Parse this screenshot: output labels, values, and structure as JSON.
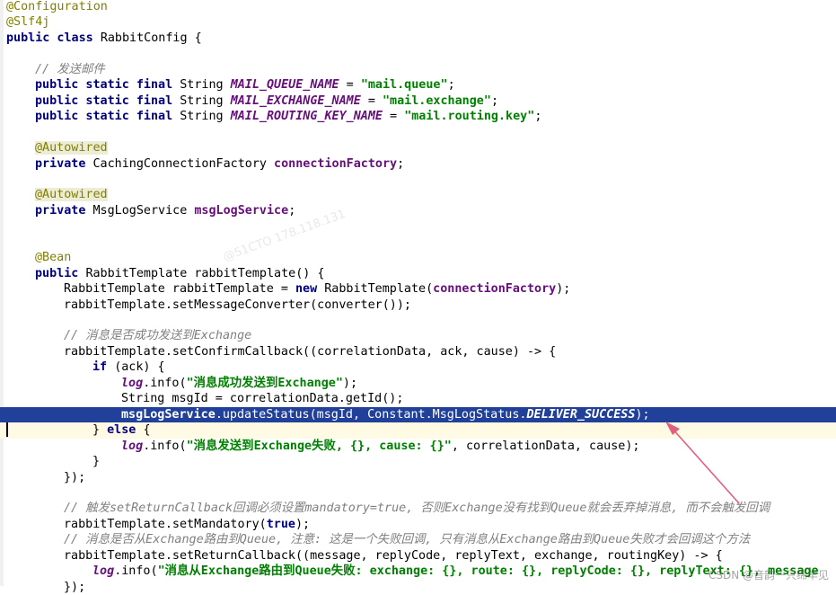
{
  "editor": {
    "lines": [
      {
        "indent": 0,
        "tokens": [
          {
            "t": "@Configuration",
            "c": "ann"
          }
        ]
      },
      {
        "indent": 0,
        "tokens": [
          {
            "t": "@Slf4j",
            "c": "ann"
          }
        ]
      },
      {
        "indent": 0,
        "tokens": [
          {
            "t": "public class ",
            "c": "kw"
          },
          {
            "t": "RabbitConfig {",
            "c": ""
          }
        ]
      },
      {
        "indent": 0,
        "tokens": []
      },
      {
        "indent": 1,
        "tokens": [
          {
            "t": "// 发送邮件",
            "c": "cmt"
          }
        ]
      },
      {
        "indent": 1,
        "tokens": [
          {
            "t": "public static final ",
            "c": "kw"
          },
          {
            "t": "String ",
            "c": ""
          },
          {
            "t": "MAIL_QUEUE_NAME",
            "c": "fld"
          },
          {
            "t": " = ",
            "c": ""
          },
          {
            "t": "\"mail.queue\"",
            "c": "str"
          },
          {
            "t": ";",
            "c": ""
          }
        ]
      },
      {
        "indent": 1,
        "tokens": [
          {
            "t": "public static final ",
            "c": "kw"
          },
          {
            "t": "String ",
            "c": ""
          },
          {
            "t": "MAIL_EXCHANGE_NAME",
            "c": "fld"
          },
          {
            "t": " = ",
            "c": ""
          },
          {
            "t": "\"mail.exchange\"",
            "c": "str"
          },
          {
            "t": ";",
            "c": ""
          }
        ]
      },
      {
        "indent": 1,
        "tokens": [
          {
            "t": "public static final ",
            "c": "kw"
          },
          {
            "t": "String ",
            "c": ""
          },
          {
            "t": "MAIL_ROUTING_KEY_NAME",
            "c": "fld"
          },
          {
            "t": " = ",
            "c": ""
          },
          {
            "t": "\"mail.routing.key\"",
            "c": "str"
          },
          {
            "t": ";",
            "c": ""
          }
        ]
      },
      {
        "indent": 0,
        "tokens": []
      },
      {
        "indent": 1,
        "tokens": [
          {
            "t": "@Autowired",
            "c": "ann boxed"
          }
        ]
      },
      {
        "indent": 1,
        "tokens": [
          {
            "t": "private ",
            "c": "kw"
          },
          {
            "t": "CachingConnectionFactory ",
            "c": ""
          },
          {
            "t": "connectionFactory",
            "c": "inst"
          },
          {
            "t": ";",
            "c": ""
          }
        ]
      },
      {
        "indent": 0,
        "tokens": []
      },
      {
        "indent": 1,
        "tokens": [
          {
            "t": "@Autowired",
            "c": "ann boxed"
          }
        ]
      },
      {
        "indent": 1,
        "tokens": [
          {
            "t": "private ",
            "c": "kw"
          },
          {
            "t": "MsgLogService ",
            "c": ""
          },
          {
            "t": "msgLogService",
            "c": "inst"
          },
          {
            "t": ";",
            "c": ""
          }
        ]
      },
      {
        "indent": 0,
        "tokens": []
      },
      {
        "indent": 0,
        "tokens": []
      },
      {
        "indent": 1,
        "tokens": [
          {
            "t": "@Bean",
            "c": "ann"
          }
        ]
      },
      {
        "indent": 1,
        "tokens": [
          {
            "t": "public ",
            "c": "kw"
          },
          {
            "t": "RabbitTemplate rabbitTemplate() {",
            "c": ""
          }
        ]
      },
      {
        "indent": 2,
        "tokens": [
          {
            "t": "RabbitTemplate rabbitTemplate = ",
            "c": ""
          },
          {
            "t": "new ",
            "c": "kw"
          },
          {
            "t": "RabbitTemplate(",
            "c": ""
          },
          {
            "t": "connectionFactory",
            "c": "inst"
          },
          {
            "t": ");",
            "c": ""
          }
        ]
      },
      {
        "indent": 2,
        "tokens": [
          {
            "t": "rabbitTemplate.setMessageConverter(converter());",
            "c": ""
          }
        ]
      },
      {
        "indent": 0,
        "tokens": []
      },
      {
        "indent": 2,
        "tokens": [
          {
            "t": "// 消息是否成功发送到Exchange",
            "c": "cmt"
          }
        ]
      },
      {
        "indent": 2,
        "tokens": [
          {
            "t": "rabbitTemplate.setConfirmCallback((correlationData, ack, cause) -> {",
            "c": ""
          }
        ]
      },
      {
        "indent": 3,
        "tokens": [
          {
            "t": "if ",
            "c": "kw"
          },
          {
            "t": "(ack) {",
            "c": ""
          }
        ]
      },
      {
        "indent": 4,
        "tokens": [
          {
            "t": "log",
            "c": "fld"
          },
          {
            "t": ".info(",
            "c": ""
          },
          {
            "t": "\"消息成功发送到Exchange\"",
            "c": "str"
          },
          {
            "t": ");",
            "c": ""
          }
        ]
      },
      {
        "indent": 4,
        "tokens": [
          {
            "t": "String msgId = correlationData.getId();",
            "c": ""
          }
        ]
      },
      {
        "indent": 4,
        "tokens": [
          {
            "t": "msgLogService",
            "c": "inst"
          },
          {
            "t": ".updateStatus(msgId, Constant.MsgLogStatus.",
            "c": ""
          },
          {
            "t": "DELIVER_SUCCESS",
            "c": "fld"
          },
          {
            "t": ");",
            "c": ""
          }
        ],
        "highlight": true
      },
      {
        "indent": 3,
        "tokens": [
          {
            "t": "} ",
            "c": ""
          },
          {
            "t": "else ",
            "c": "kw"
          },
          {
            "t": "{",
            "c": ""
          }
        ],
        "caret": true
      },
      {
        "indent": 4,
        "tokens": [
          {
            "t": "log",
            "c": "fld"
          },
          {
            "t": ".info(",
            "c": ""
          },
          {
            "t": "\"消息发送到Exchange失败, {}, cause: {}\"",
            "c": "str"
          },
          {
            "t": ", correlationData, cause);",
            "c": ""
          }
        ]
      },
      {
        "indent": 3,
        "tokens": [
          {
            "t": "}",
            "c": ""
          }
        ]
      },
      {
        "indent": 2,
        "tokens": [
          {
            "t": "});",
            "c": ""
          }
        ]
      },
      {
        "indent": 0,
        "tokens": []
      },
      {
        "indent": 2,
        "tokens": [
          {
            "t": "// 触发setReturnCallback回调必须设置mandatory=true, 否则Exchange没有找到Queue就会丢弃掉消息, 而不会触发回调",
            "c": "cmt"
          }
        ]
      },
      {
        "indent": 2,
        "tokens": [
          {
            "t": "rabbitTemplate.setMandatory(",
            "c": ""
          },
          {
            "t": "true",
            "c": "kw"
          },
          {
            "t": ");",
            "c": ""
          }
        ]
      },
      {
        "indent": 2,
        "tokens": [
          {
            "t": "// 消息是否从Exchange路由到Queue, 注意: 这是一个失败回调, 只有消息从Exchange路由到Queue失败才会回调这个方法",
            "c": "cmt"
          }
        ]
      },
      {
        "indent": 2,
        "tokens": [
          {
            "t": "rabbitTemplate.setReturnCallback((message, replyCode, replyText, exchange, routingKey) -> {",
            "c": ""
          }
        ]
      },
      {
        "indent": 3,
        "tokens": [
          {
            "t": "log",
            "c": "fld"
          },
          {
            "t": ".info(",
            "c": ""
          },
          {
            "t": "\"消息从Exchange路由到Queue失败: exchange: {}, route: {}, replyCode: {}, replyText: {}, message",
            "c": "str"
          }
        ]
      },
      {
        "indent": 2,
        "tokens": [
          {
            "t": "});",
            "c": ""
          }
        ]
      }
    ]
  },
  "overlay": {
    "watermark": "@51CTO 178.118.131",
    "credit": "CSDN @音韵一只绵羊见"
  },
  "colors": {
    "highlight_line": "#21409a",
    "arrow": "#e0607e"
  }
}
